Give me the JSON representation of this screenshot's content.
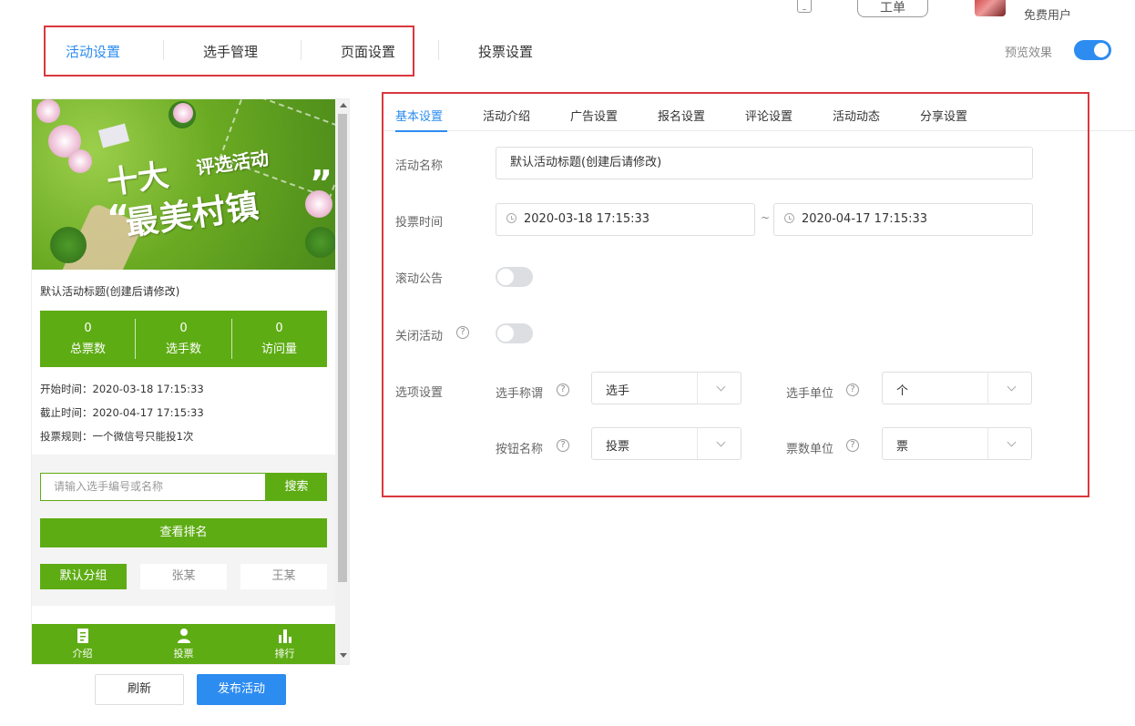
{
  "topbar": {
    "ticket_label": "工单",
    "user_name": " ",
    "user_type": "免费用户"
  },
  "main_tabs": [
    {
      "label": "活动设置",
      "active": true
    },
    {
      "label": "选手管理",
      "active": false
    },
    {
      "label": "页面设置",
      "active": false
    },
    {
      "label": "投票设置",
      "active": false
    }
  ],
  "preview_toggle": {
    "label": "预览效果",
    "on": true
  },
  "preview": {
    "banner": {
      "line1": "十大",
      "line1b": "评选活动",
      "line2": "最美村镇",
      "quote_open": "“",
      "quote_close": "”"
    },
    "title": "默认活动标题(创建后请修改)",
    "stats": [
      {
        "value": "0",
        "label": "总票数"
      },
      {
        "value": "0",
        "label": "选手数"
      },
      {
        "value": "0",
        "label": "访问量"
      }
    ],
    "info": {
      "start": "开始时间：2020-03-18 17:15:33",
      "end": "截止时间：2020-04-17 17:15:33",
      "rule": "投票规则：一个微信号只能投1次"
    },
    "search_placeholder": "请输入选手编号或名称",
    "search_button": "搜索",
    "rank_button": "查看排名",
    "groups": [
      {
        "label": "默认分组",
        "active": true
      },
      {
        "label": "张某",
        "active": false
      },
      {
        "label": "王某",
        "active": false
      }
    ],
    "nav": [
      {
        "label": "介绍",
        "icon": "doc-icon"
      },
      {
        "label": "投票",
        "icon": "user-icon"
      },
      {
        "label": "排行",
        "icon": "bar-chart-icon"
      }
    ]
  },
  "actions": {
    "refresh": "刷新",
    "publish": "发布活动"
  },
  "settings": {
    "tabs": [
      {
        "label": "基本设置",
        "active": true
      },
      {
        "label": "活动介绍",
        "active": false
      },
      {
        "label": "广告设置",
        "active": false
      },
      {
        "label": "报名设置",
        "active": false
      },
      {
        "label": "评论设置",
        "active": false
      },
      {
        "label": "活动动态",
        "active": false
      },
      {
        "label": "分享设置",
        "active": false
      }
    ],
    "name_label": "活动名称",
    "name_value": "默认活动标题(创建后请修改)",
    "time_label": "投票时间",
    "time_start": "2020-03-18 17:15:33",
    "time_sep": "~",
    "time_end": "2020-04-17 17:15:33",
    "marquee_label": "滚动公告",
    "marquee_on": false,
    "close_label": "关闭活动",
    "close_on": false,
    "options_label": "选项设置",
    "options": {
      "contestant_title_label": "选手称谓",
      "contestant_title_value": "选手",
      "contestant_unit_label": "选手单位",
      "contestant_unit_value": "个",
      "button_name_label": "按钮名称",
      "button_name_value": "投票",
      "vote_unit_label": "票数单位",
      "vote_unit_value": "票"
    },
    "help_glyph": "?"
  },
  "colors": {
    "accent": "#2d8cf0",
    "brand_green": "#5eac14",
    "highlight": "#d9383e"
  }
}
